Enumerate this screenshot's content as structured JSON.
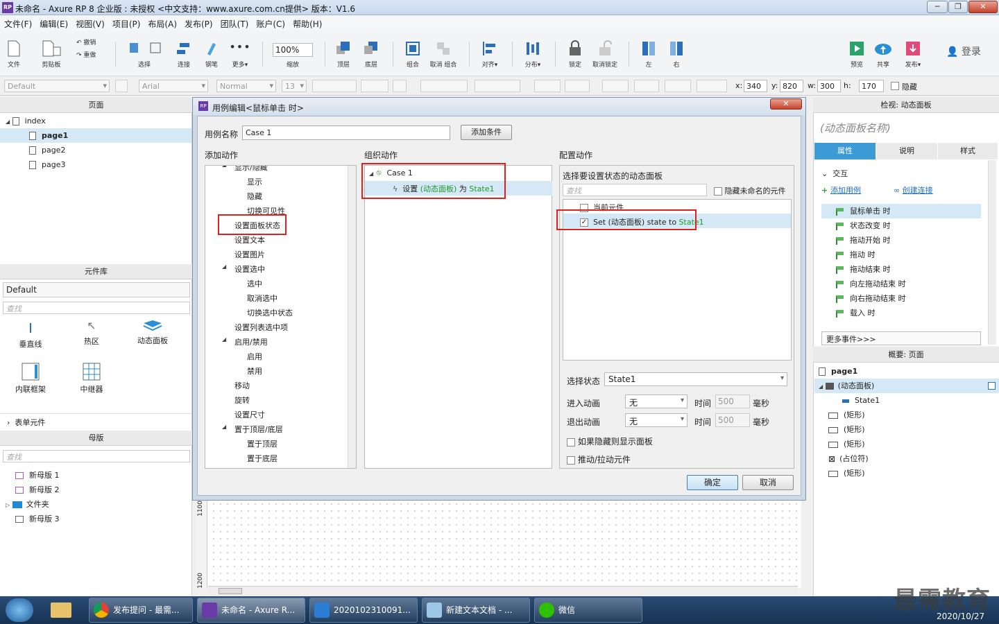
{
  "window": {
    "title": "未命名 - Axure RP 8 企业版 : 未授权   <中文支持：www.axure.com.cn提供> 版本：V1.6",
    "logo": "RP",
    "controls": [
      "─",
      "❐",
      "✕"
    ]
  },
  "menu": [
    "文件(F)",
    "编辑(E)",
    "视图(V)",
    "项目(P)",
    "布局(A)",
    "发布(P)",
    "团队(T)",
    "账户(C)",
    "帮助(H)"
  ],
  "toolbar": {
    "file": "文件",
    "clipboard": "剪贴板",
    "undo": "撤销",
    "redo": "重做",
    "select": "选择",
    "connect": "连接",
    "pen": "钢笔",
    "more": "更多▾",
    "zoom": "100%",
    "zoom_label": "缩放",
    "top": "顶层",
    "bottom": "底层",
    "group": "组合",
    "ungroup": "取消 组合",
    "align": "对齐▾",
    "distribute": "分布▾",
    "lock": "锁定",
    "unlock": "取消锁定",
    "left": "左",
    "right": "右",
    "preview": "预览",
    "share": "共享",
    "publish": "发布▾",
    "login": "登录"
  },
  "format": {
    "style": "Default",
    "font": "Arial",
    "weight": "Normal",
    "size": "13",
    "x_label": "x:",
    "x": "340",
    "y_label": "y:",
    "y": "820",
    "w_label": "w:",
    "w": "300",
    "h_label": "h:",
    "h": "170",
    "hide": "隐藏"
  },
  "pages_panel": {
    "title": "页面",
    "root": "index",
    "pages": [
      "page1",
      "page2",
      "page3"
    ]
  },
  "library_panel": {
    "title": "元件库",
    "selected": "Default",
    "search_placeholder": "查找",
    "widgets": [
      "垂直线",
      "热区",
      "动态面板",
      "内联框架",
      "中继器"
    ],
    "section": "表单元件"
  },
  "masters_panel": {
    "title": "母版",
    "search_placeholder": "查找",
    "items": [
      "新母版 1",
      "新母版 2",
      "文件夹",
      "新母版 3"
    ]
  },
  "dialog": {
    "title": "用例编辑<鼠标单击 时>",
    "case_name_label": "用例名称",
    "case_name": "Case 1",
    "add_condition": "添加条件",
    "add_action_title": "添加动作",
    "organize_title": "组织动作",
    "configure_title": "配置动作",
    "actions": [
      {
        "label": "显示/隐藏",
        "level": 1,
        "expand": true
      },
      {
        "label": "显示",
        "level": 2
      },
      {
        "label": "隐藏",
        "level": 2
      },
      {
        "label": "切换可见性",
        "level": 2
      },
      {
        "label": "设置面板状态",
        "level": 1
      },
      {
        "label": "设置文本",
        "level": 1
      },
      {
        "label": "设置图片",
        "level": 1
      },
      {
        "label": "设置选中",
        "level": 1,
        "expand": true
      },
      {
        "label": "选中",
        "level": 2
      },
      {
        "label": "取消选中",
        "level": 2
      },
      {
        "label": "切换选中状态",
        "level": 2
      },
      {
        "label": "设置列表选中项",
        "level": 1
      },
      {
        "label": "启用/禁用",
        "level": 1,
        "expand": true
      },
      {
        "label": "启用",
        "level": 2
      },
      {
        "label": "禁用",
        "level": 2
      },
      {
        "label": "移动",
        "level": 1
      },
      {
        "label": "旋转",
        "level": 1
      },
      {
        "label": "设置尺寸",
        "level": 1
      },
      {
        "label": "置于顶层/底层",
        "level": 1,
        "expand": true
      },
      {
        "label": "置于顶层",
        "level": 2
      },
      {
        "label": "置于底层",
        "level": 2
      }
    ],
    "case_node": "Case 1",
    "action_prefix": "设置",
    "action_target": "(动态面板)",
    "action_mid": "为",
    "action_state": "State1",
    "configure_subtitle": "选择要设置状态的动态面板",
    "search_placeholder": "查找",
    "hide_unnamed": "隐藏未命名的元件",
    "current_widget": "当前元件",
    "panel_row_prefix": "Set (动态面板) state to",
    "panel_row_state": "State1",
    "select_state_label": "选择状态",
    "select_state": "State1",
    "enter_anim_label": "进入动画",
    "exit_anim_label": "退出动画",
    "anim_none": "无",
    "time_label": "时间",
    "time_value": "500",
    "ms": "毫秒",
    "show_if_hidden": "如果隐藏则显示面板",
    "push_pull": "推动/拉动元件",
    "ok": "确定",
    "cancel": "取消"
  },
  "inspector": {
    "title": "检视: 动态面板",
    "name_placeholder": "(动态面板名称)",
    "tabs": [
      "属性",
      "说明",
      "样式"
    ],
    "section": "交互",
    "add_case": "添加用例",
    "create_link": "创建连接",
    "events": [
      "鼠标单击 时",
      "状态改变 时",
      "拖动开始 时",
      "拖动 时",
      "拖动结束 时",
      "向左拖动结束 时",
      "向右拖动结束 时",
      "载入 时"
    ],
    "more_events": "更多事件>>>"
  },
  "outline": {
    "title": "概要: 页面",
    "page": "page1",
    "panel": "(动态面板)",
    "state": "State1",
    "items": [
      "(矩形)",
      "(矩形)",
      "(矩形)",
      "(占位符)",
      "(矩形)"
    ]
  },
  "ruler": {
    "v1": "1100",
    "v2": "1200"
  },
  "taskbar": {
    "tasks": [
      "发布提问 - 最需...",
      "未命名 - Axure R...",
      "2020102310091...",
      "新建文本文档 - ...",
      "微信"
    ],
    "clock_date": "2020/10/27"
  },
  "watermark": "最需教育",
  "colors": {
    "accent": "#3c9ad6",
    "highlight": "#d5e8f6",
    "red_mark": "#e0201c",
    "green_text": "#1c9a2a"
  }
}
